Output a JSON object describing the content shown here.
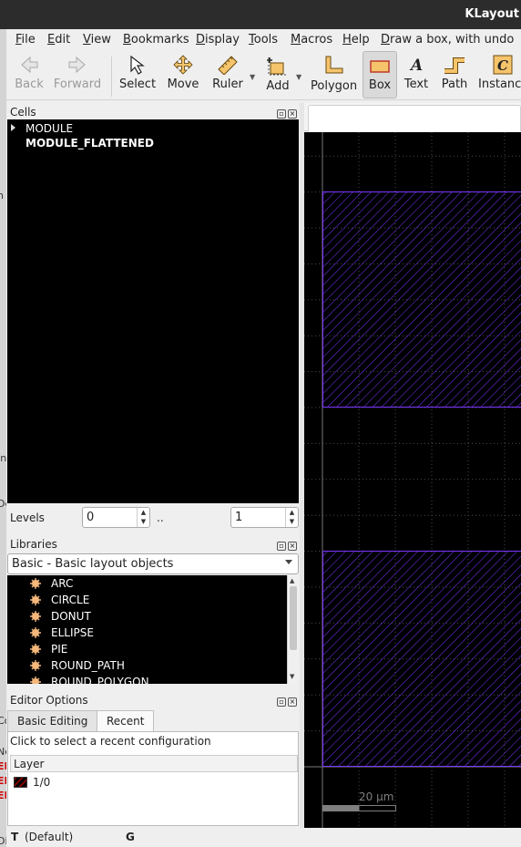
{
  "window": {
    "title": "KLayout"
  },
  "left_strip": {
    "glyphs": [
      "n",
      "In",
      "De",
      "Co",
      "I",
      "Ne",
      "EI",
      "EI",
      "EI",
      "Di"
    ]
  },
  "menu": {
    "items": [
      "File",
      "Edit",
      "View",
      "Bookmarks",
      "Display",
      "Tools",
      "Macros",
      "Help"
    ],
    "status": "Draw a box, with undo"
  },
  "toolbar": {
    "back": "Back",
    "forward": "Forward",
    "select": "Select",
    "move": "Move",
    "ruler": "Ruler",
    "add": "Add",
    "polygon": "Polygon",
    "box": "Box",
    "text": "Text",
    "path": "Path",
    "instance": "Instance"
  },
  "cells": {
    "title": "Cells",
    "items": [
      {
        "name": "MODULE",
        "expandable": true
      },
      {
        "name": "MODULE_FLATTENED",
        "bold": true
      }
    ]
  },
  "levels": {
    "label": "Levels",
    "min": "0",
    "separator": "..",
    "max": "1"
  },
  "libraries": {
    "title": "Libraries",
    "selected": "Basic - Basic layout objects",
    "items": [
      "ARC",
      "CIRCLE",
      "DONUT",
      "ELLIPSE",
      "PIE",
      "ROUND_PATH",
      "ROUND_POLYGON"
    ]
  },
  "editor_options": {
    "title": "Editor Options",
    "tabs": [
      "Basic Editing",
      "Recent"
    ],
    "active_tab": "Recent",
    "hint": "Click to select a recent configuration",
    "column": "Layer",
    "rows": [
      "1/0"
    ]
  },
  "statusbar": {
    "mode": "T",
    "text": "(Default)",
    "grid": "G"
  },
  "canvas": {
    "scale_label": "20  µm",
    "background": "#000000",
    "shape_color": "#7a35ff",
    "grid_color": "#4a4a4a"
  },
  "colors": {
    "accent_box_active": "#dadada",
    "panel_bg": "#000000"
  }
}
